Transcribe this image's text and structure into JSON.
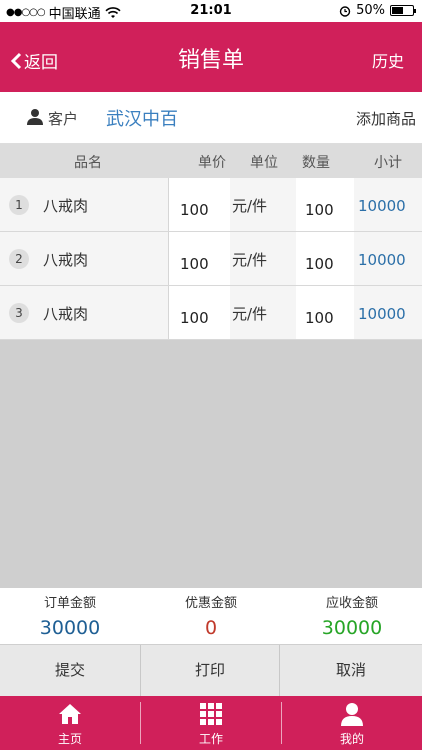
{
  "status_bar": {
    "carrier": "中国联通",
    "time": "21:01",
    "battery": "50%",
    "battery_level": 0.5
  },
  "nav": {
    "back_label": "返回",
    "title": "销售单",
    "history_label": "历史"
  },
  "customer": {
    "label": "客户",
    "name": "武汉中百",
    "add_goods_label": "添加商品"
  },
  "table": {
    "headers": {
      "name": "品名",
      "price": "单价",
      "unit": "单位",
      "qty": "数量",
      "subtotal": "小计"
    },
    "rows": [
      {
        "index": "1",
        "name": "八戒肉",
        "price": "100",
        "unit": "元/件",
        "qty": "100",
        "subtotal": "10000"
      },
      {
        "index": "2",
        "name": "八戒肉",
        "price": "100",
        "unit": "元/件",
        "qty": "100",
        "subtotal": "10000"
      },
      {
        "index": "3",
        "name": "八戒肉",
        "price": "100",
        "unit": "元/件",
        "qty": "100",
        "subtotal": "10000"
      }
    ]
  },
  "totals": {
    "order_label": "订单金额",
    "order_value": "30000",
    "discount_label": "优惠金额",
    "discount_value": "0",
    "receivable_label": "应收金额",
    "receivable_value": "30000"
  },
  "actions": {
    "submit": "提交",
    "print": "打印",
    "cancel": "取消"
  },
  "tabs": [
    {
      "label": "主页",
      "icon": "home-icon"
    },
    {
      "label": "工作",
      "icon": "grid-icon"
    },
    {
      "label": "我的",
      "icon": "user-icon"
    }
  ],
  "colors": {
    "brand": "#d0205a",
    "link": "#3a7fbf",
    "order_value": "#1f5f94",
    "discount_value": "#c0392b",
    "receivable_value": "#27a527"
  }
}
